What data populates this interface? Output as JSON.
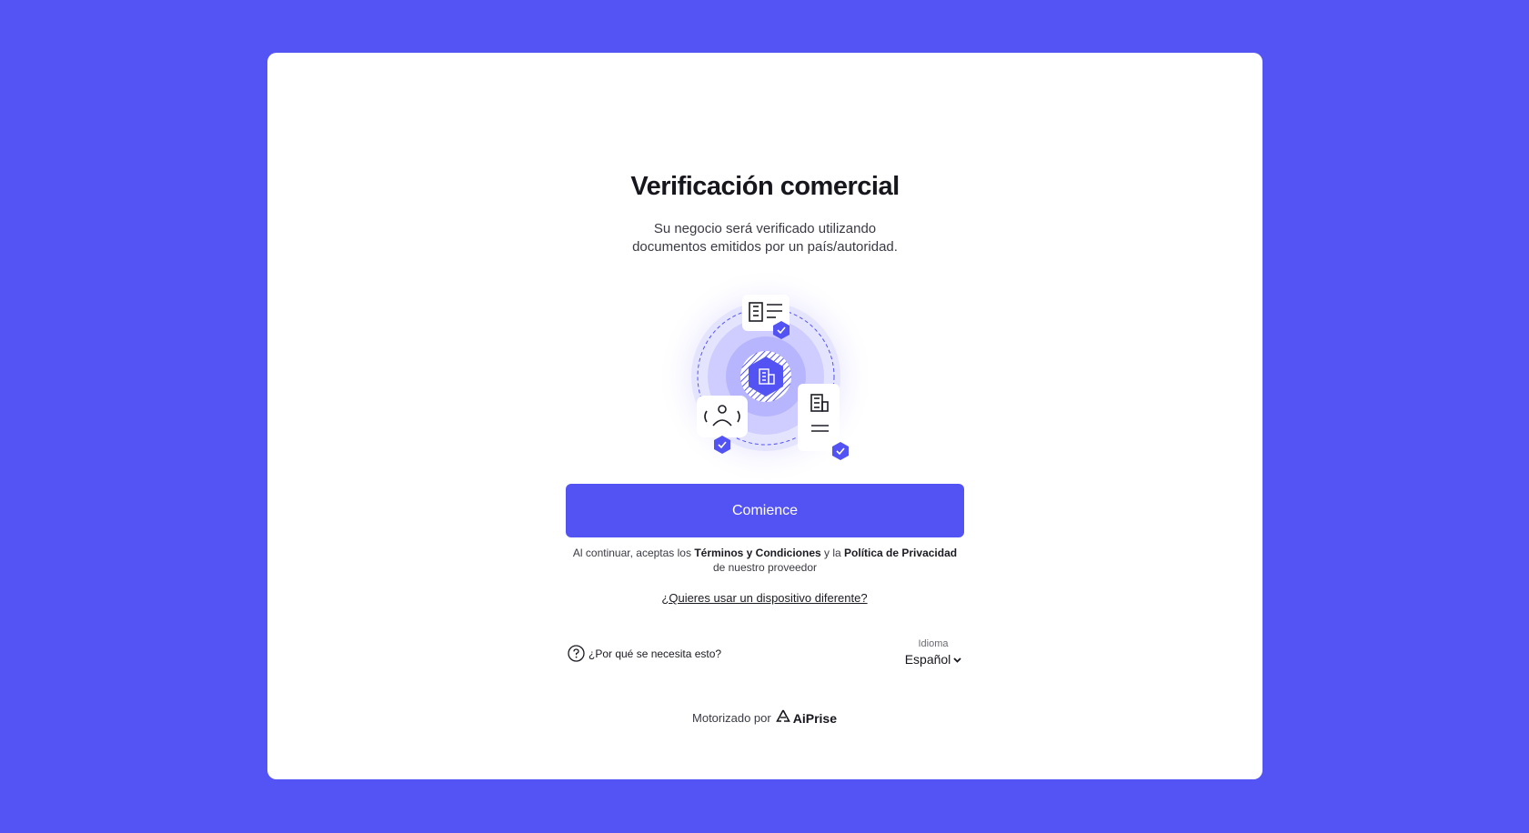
{
  "card": {
    "title": "Verificación comercial",
    "subtitle_line1": "Su negocio será verificado utilizando",
    "subtitle_line2": "documentos emitidos por un país/autoridad."
  },
  "actions": {
    "start_label": "Comience",
    "terms_prefix": "Al continuar, aceptas los ",
    "terms_link": "Términos y Condiciones",
    "terms_middle": " y la ",
    "privacy_link": "Política de Privacidad",
    "terms_suffix": " de nuestro proveedor",
    "device_link": "¿Quieres usar un dispositivo diferente?"
  },
  "footer": {
    "why_label": "¿Por qué se necesita esto?",
    "language_label": "Idioma",
    "language_value": "Español",
    "powered_by": "Motorizado por",
    "brand": "AiPrise"
  },
  "colors": {
    "background": "#5454F5",
    "accent": "#5353F4",
    "card": "#FFFFFF"
  },
  "icons": {
    "illustration": "business-verification-illustration",
    "help": "question-circle-icon",
    "language_chevron": "chevron-down-icon",
    "brand_logo": "aiprise-logo-icon"
  }
}
